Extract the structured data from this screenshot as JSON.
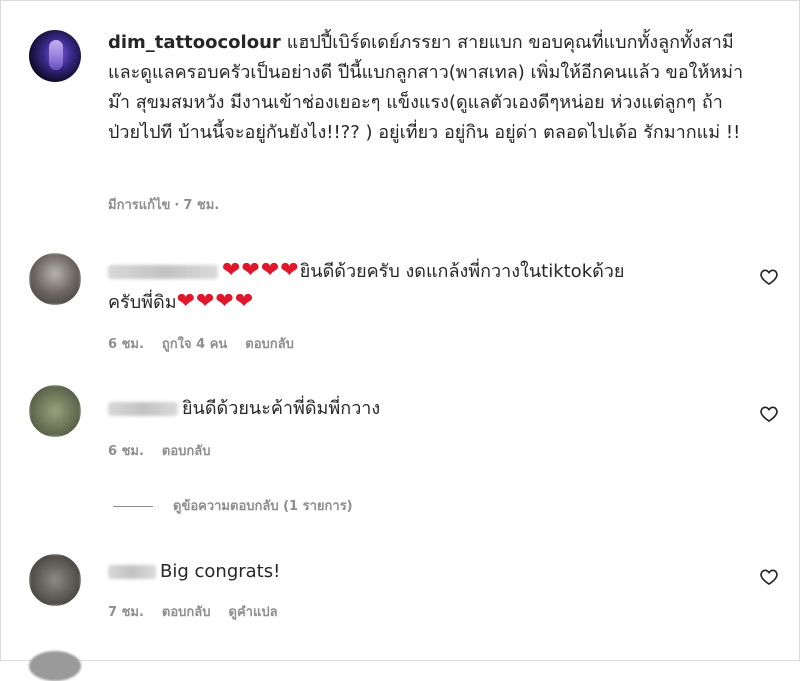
{
  "caption": {
    "username": "dim_tattoocolour",
    "text": "แฮปปี้เบิร์ดเดย์ภรรยา สายแบก ขอบคุณที่แบกทั้งลูกทั้งสามี และดูแลครอบครัวเป็นอย่างดี ปีนี้แบกลูกสาว(พาสเทล) เพิ่มให้อีกคนแล้ว ขอให้หม่าม๊า สุขมสมหวัง มีงานเข้าช่องเยอะๆ แข็งแรง(ดูแลตัวเองดีๆหน่อย ห่วงแต่ลูกๆ ถ้าป่วยไปที บ้านนี้จะอยู่กันยังไง!!?? ) อยู่เที่ยว อยู่กิน อยู่ด่า ตลอดไปเด้อ รักมากแม่ !!",
    "edited": "มีการแก้ไข",
    "time": "7 ชม."
  },
  "comments": [
    {
      "hearts_before": "❤❤❤❤",
      "text_line1": "ยินดีด้วยครับ งดแกล้งพี่กวางในtiktokด้วย",
      "text_line2": "ครับพี่ดิม",
      "hearts_after": "❤❤❤❤",
      "time": "6 ชม.",
      "likes": "ถูกใจ 4 คน",
      "reply": "ตอบกลับ"
    },
    {
      "text": "ยินดีด้วยนะค้าพี่ดิมพี่กวาง",
      "time": "6 ชม.",
      "reply": "ตอบกลับ",
      "view_replies": "ดูข้อความตอบกลับ (1 รายการ)"
    },
    {
      "text": "Big congrats!",
      "time": "7 ชม.",
      "reply": "ตอบกลับ",
      "translate": "ดูคำแปล"
    }
  ],
  "colors": {
    "text": "#262626",
    "muted": "#8e8e8e",
    "heart": "#e0162b"
  },
  "icons": {
    "like": "heart-outline-icon"
  }
}
